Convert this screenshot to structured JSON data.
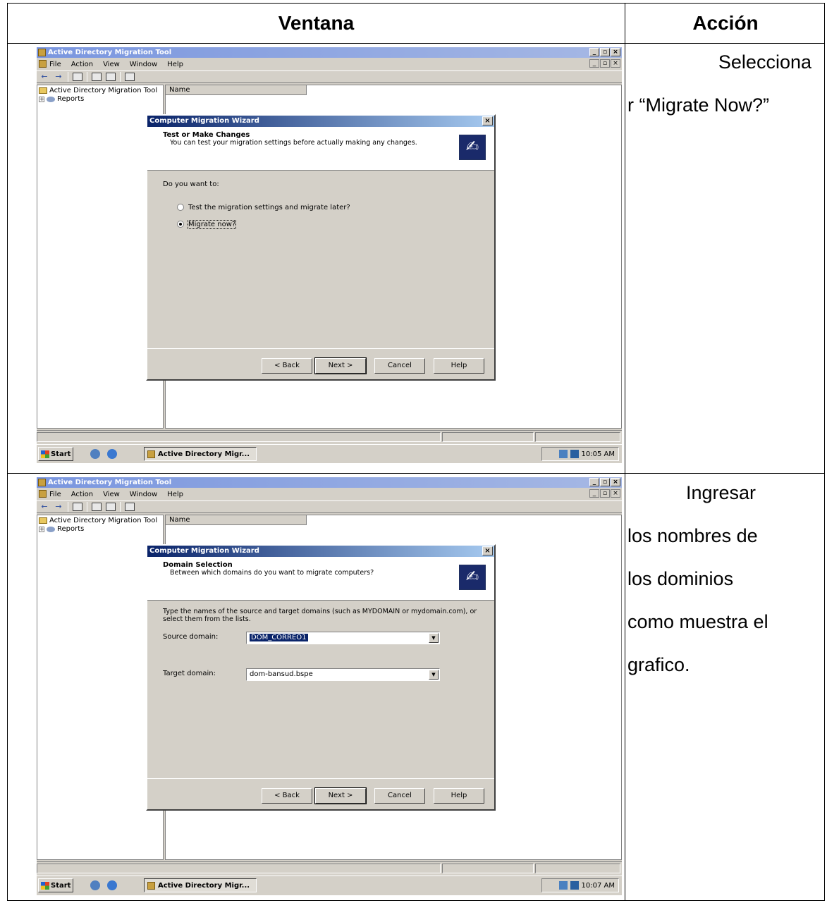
{
  "table": {
    "header_window": "Ventana",
    "header_action": "Acción"
  },
  "rows": [
    {
      "action_line1": "Selecciona",
      "action_rest": [
        "r “Migrate Now?”"
      ],
      "screenshot": {
        "app_title": "Active Directory Migration Tool",
        "menu": [
          "File",
          "Action",
          "View",
          "Window",
          "Help"
        ],
        "tree_root": "Active Directory Migration Tool",
        "tree_child": "Reports",
        "list_column": "Name",
        "dialog_title": "Computer Migration Wizard",
        "page_title": "Test or Make Changes",
        "page_subtitle": "You can test your migration settings before actually making any changes.",
        "prompt": "Do you want to:",
        "options": [
          "Test the migration settings and migrate later?",
          "Migrate now?"
        ],
        "selected_option": 1,
        "buttons": {
          "back": "< Back",
          "next": "Next >",
          "cancel": "Cancel",
          "help": "Help"
        },
        "taskbar_start": "Start",
        "taskbar_task": "Active Directory Migr...",
        "clock": "10:05 AM"
      }
    },
    {
      "action_line1": "Ingresar",
      "action_rest": [
        "los nombres de",
        "los dominios",
        "como muestra el",
        "grafico."
      ],
      "screenshot": {
        "app_title": "Active Directory Migration Tool",
        "menu": [
          "File",
          "Action",
          "View",
          "Window",
          "Help"
        ],
        "tree_root": "Active Directory Migration Tool",
        "tree_child": "Reports",
        "list_column": "Name",
        "dialog_title": "Computer Migration Wizard",
        "page_title": "Domain Selection",
        "page_subtitle": "Between which domains do you want to migrate computers?",
        "instructions": "Type the names of the source and target domains (such as MYDOMAIN or mydomain.com), or select them from the lists.",
        "source_label": "Source domain:",
        "source_value": "DOM_CORREO1",
        "target_label": "Target domain:",
        "target_value": "dom-bansud.bspe",
        "buttons": {
          "back": "< Back",
          "next": "Next >",
          "cancel": "Cancel",
          "help": "Help"
        },
        "taskbar_start": "Start",
        "taskbar_task": "Active Directory Migr...",
        "clock": "10:07 AM"
      }
    }
  ]
}
